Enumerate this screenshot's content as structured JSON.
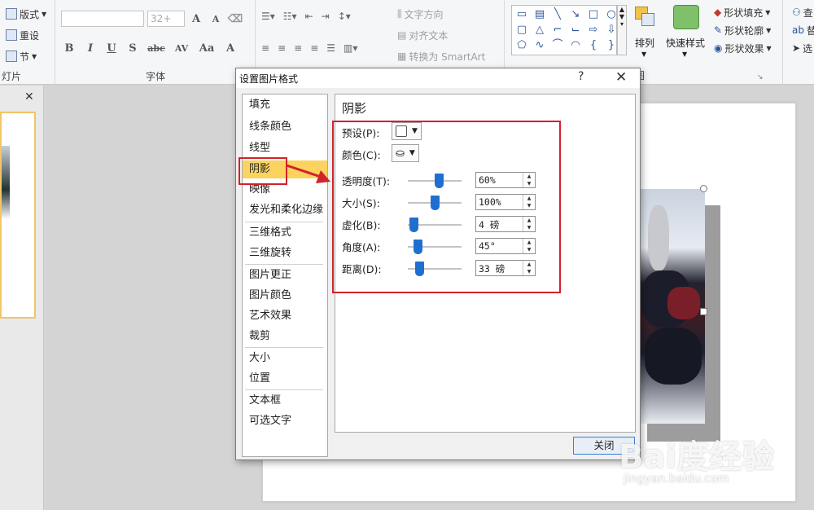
{
  "ribbon": {
    "slides_group": {
      "layout_label": "版式",
      "reset_label": "重设",
      "section_label": "节",
      "group_label": "灯片"
    },
    "font_group": {
      "font_size": "32+",
      "group_label": "字体",
      "buttons": [
        "B",
        "I",
        "U",
        "S",
        "abc",
        "AV",
        "Aa",
        "A"
      ]
    },
    "paragraph_group": {
      "text_direction_label": "文字方向",
      "align_text_label": "对齐文本",
      "smartart_label": "转换为 SmartArt"
    },
    "drawing_group": {
      "arrange_label": "排列",
      "quick_styles_label": "快速样式",
      "shape_fill_label": "形状填充",
      "shape_outline_label": "形状轮廓",
      "shape_effects_label": "形状效果",
      "partial_label": "图"
    },
    "editing_group": {
      "find_label": "查",
      "replace_label": "替",
      "select_label": "选"
    }
  },
  "dialog": {
    "title": "设置图片格式",
    "help": "?",
    "close_x": "✕",
    "categories": [
      "填充",
      "线条颜色",
      "线型",
      "阴影",
      "映像",
      "发光和柔化边缘",
      "三维格式",
      "三维旋转",
      "图片更正",
      "图片颜色",
      "艺术效果",
      "裁剪",
      "大小",
      "位置",
      "文本框",
      "可选文字"
    ],
    "selected_category": "阴影",
    "panel_title": "阴影",
    "preset_label": "预设(P):",
    "color_label": "颜色(C):",
    "sliders": [
      {
        "label": "透明度(T):",
        "value": "60%",
        "level": 0.6
      },
      {
        "label": "大小(S):",
        "value": "100%",
        "level": 0.5
      },
      {
        "label": "虚化(B):",
        "value": "4 磅",
        "level": 0.04
      },
      {
        "label": "角度(A):",
        "value": "45°",
        "level": 0.125
      },
      {
        "label": "距离(D):",
        "value": "33 磅",
        "level": 0.165
      }
    ],
    "close_button": "关闭"
  },
  "pane": {
    "close_icon": "✕"
  },
  "watermark": {
    "brand": "Bai度经验",
    "url": "jingyan.baidu.com"
  },
  "colors": {
    "selected": "#fcd35f",
    "annotation": "#d2222a",
    "slider_thumb": "#1f6fd0"
  }
}
